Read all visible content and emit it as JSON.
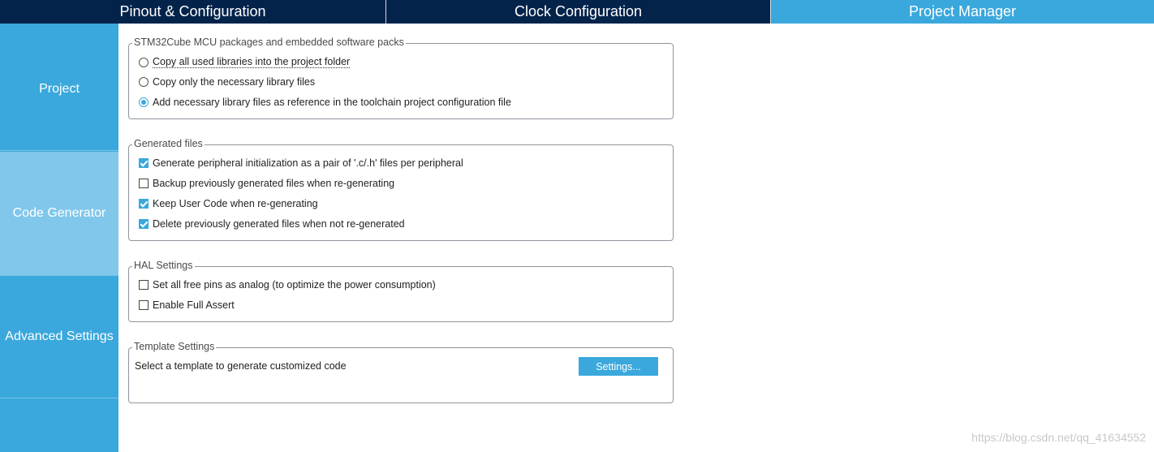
{
  "tabs": [
    {
      "label": "Pinout & Configuration"
    },
    {
      "label": "Clock Configuration"
    },
    {
      "label": "Project Manager"
    }
  ],
  "sidebar": {
    "items": [
      {
        "label": "Project"
      },
      {
        "label": "Code Generator"
      },
      {
        "label": "Advanced Settings"
      }
    ]
  },
  "groups": {
    "packs": {
      "title": "STM32Cube MCU packages and embedded software packs",
      "options": [
        {
          "label": "Copy all used libraries into the project folder",
          "selected": false
        },
        {
          "label": "Copy only the necessary library files",
          "selected": false
        },
        {
          "label": "Add necessary library files as reference in the toolchain project configuration file",
          "selected": true
        }
      ]
    },
    "generated": {
      "title": "Generated files",
      "options": [
        {
          "label": "Generate peripheral initialization as a pair of '.c/.h' files per peripheral",
          "checked": true
        },
        {
          "label": "Backup previously generated files when re-generating",
          "checked": false
        },
        {
          "label": "Keep User Code when re-generating",
          "checked": true
        },
        {
          "label": "Delete previously generated files when not re-generated",
          "checked": true
        }
      ]
    },
    "hal": {
      "title": "HAL Settings",
      "options": [
        {
          "label": "Set all free pins as analog (to optimize the power consumption)",
          "checked": false
        },
        {
          "label": "Enable Full Assert",
          "checked": false
        }
      ]
    },
    "template": {
      "title": "Template Settings",
      "description": "Select a template to generate customized code",
      "button": "Settings..."
    }
  },
  "colors": {
    "navy": "#03234b",
    "accent": "#3aa8dc",
    "sidebar_active": "#80c7eb"
  },
  "watermark": "https://blog.csdn.net/qq_41634552"
}
